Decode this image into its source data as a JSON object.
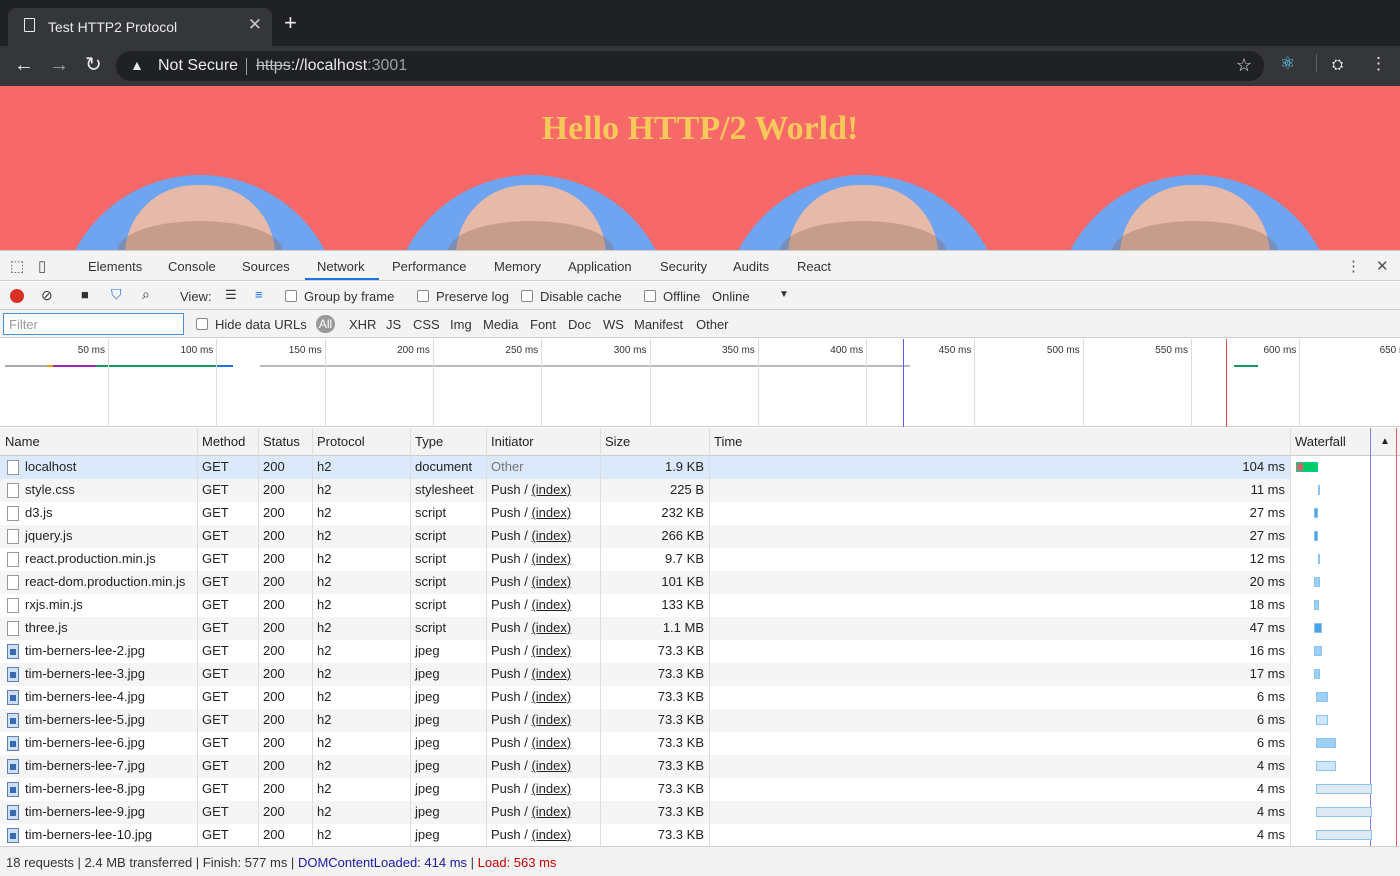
{
  "browser": {
    "tab_title": "Test HTTP2 Protocol",
    "close_glyph": "✕",
    "new_tab_glyph": "+",
    "security_label": "Not Secure",
    "url_scheme": "https",
    "url_rest": "://localhost",
    "url_port": ":3001"
  },
  "page": {
    "heading": "Hello HTTP/2 World!",
    "background": "#f76868",
    "heading_color": "#f7c95a"
  },
  "devtools": {
    "tabs": [
      "Elements",
      "Console",
      "Sources",
      "Network",
      "Performance",
      "Memory",
      "Application",
      "Security",
      "Audits",
      "React"
    ],
    "active_tab": "Network",
    "view_label": "View:",
    "group_by_frame": "Group by frame",
    "preserve_log": "Preserve log",
    "disable_cache": "Disable cache",
    "offline": "Offline",
    "throttle": "Online",
    "filter_placeholder": "Filter",
    "hide_data_urls": "Hide data URLs",
    "type_filters": [
      "All",
      "XHR",
      "JS",
      "CSS",
      "Img",
      "Media",
      "Font",
      "Doc",
      "WS",
      "Manifest",
      "Other"
    ],
    "ticks": [
      "50 ms",
      "100 ms",
      "150 ms",
      "200 ms",
      "250 ms",
      "300 ms",
      "350 ms",
      "400 ms",
      "450 ms",
      "500 ms",
      "550 ms",
      "600 ms",
      "650 n"
    ],
    "columns": [
      "Name",
      "Method",
      "Status",
      "Protocol",
      "Type",
      "Initiator",
      "Size",
      "Time",
      "Waterfall"
    ],
    "rows": [
      {
        "name": "localhost",
        "method": "GET",
        "status": "200",
        "protocol": "h2",
        "type": "document",
        "initiator": "Other",
        "size": "1.9 KB",
        "time": "104 ms",
        "icon": "file-icon"
      },
      {
        "name": "style.css",
        "method": "GET",
        "status": "200",
        "protocol": "h2",
        "type": "stylesheet",
        "initiator": "Push / ",
        "link": "(index)",
        "size": "225 B",
        "time": "11 ms",
        "icon": "file-icon"
      },
      {
        "name": "d3.js",
        "method": "GET",
        "status": "200",
        "protocol": "h2",
        "type": "script",
        "initiator": "Push / ",
        "link": "(index)",
        "size": "232 KB",
        "time": "27 ms",
        "icon": "file-icon"
      },
      {
        "name": "jquery.js",
        "method": "GET",
        "status": "200",
        "protocol": "h2",
        "type": "script",
        "initiator": "Push / ",
        "link": "(index)",
        "size": "266 KB",
        "time": "27 ms",
        "icon": "file-icon"
      },
      {
        "name": "react.production.min.js",
        "method": "GET",
        "status": "200",
        "protocol": "h2",
        "type": "script",
        "initiator": "Push / ",
        "link": "(index)",
        "size": "9.7 KB",
        "time": "12 ms",
        "icon": "file-icon"
      },
      {
        "name": "react-dom.production.min.js",
        "method": "GET",
        "status": "200",
        "protocol": "h2",
        "type": "script",
        "initiator": "Push / ",
        "link": "(index)",
        "size": "101 KB",
        "time": "20 ms",
        "icon": "file-icon"
      },
      {
        "name": "rxjs.min.js",
        "method": "GET",
        "status": "200",
        "protocol": "h2",
        "type": "script",
        "initiator": "Push / ",
        "link": "(index)",
        "size": "133 KB",
        "time": "18 ms",
        "icon": "file-icon"
      },
      {
        "name": "three.js",
        "method": "GET",
        "status": "200",
        "protocol": "h2",
        "type": "script",
        "initiator": "Push / ",
        "link": "(index)",
        "size": "1.1 MB",
        "time": "47 ms",
        "icon": "file-icon"
      },
      {
        "name": "tim-berners-lee-2.jpg",
        "method": "GET",
        "status": "200",
        "protocol": "h2",
        "type": "jpeg",
        "initiator": "Push / ",
        "link": "(index)",
        "size": "73.3 KB",
        "time": "16 ms",
        "icon": "image-icon"
      },
      {
        "name": "tim-berners-lee-3.jpg",
        "method": "GET",
        "status": "200",
        "protocol": "h2",
        "type": "jpeg",
        "initiator": "Push / ",
        "link": "(index)",
        "size": "73.3 KB",
        "time": "17 ms",
        "icon": "image-icon"
      },
      {
        "name": "tim-berners-lee-4.jpg",
        "method": "GET",
        "status": "200",
        "protocol": "h2",
        "type": "jpeg",
        "initiator": "Push / ",
        "link": "(index)",
        "size": "73.3 KB",
        "time": "6 ms",
        "icon": "image-icon"
      },
      {
        "name": "tim-berners-lee-5.jpg",
        "method": "GET",
        "status": "200",
        "protocol": "h2",
        "type": "jpeg",
        "initiator": "Push / ",
        "link": "(index)",
        "size": "73.3 KB",
        "time": "6 ms",
        "icon": "image-icon"
      },
      {
        "name": "tim-berners-lee-6.jpg",
        "method": "GET",
        "status": "200",
        "protocol": "h2",
        "type": "jpeg",
        "initiator": "Push / ",
        "link": "(index)",
        "size": "73.3 KB",
        "time": "6 ms",
        "icon": "image-icon"
      },
      {
        "name": "tim-berners-lee-7.jpg",
        "method": "GET",
        "status": "200",
        "protocol": "h2",
        "type": "jpeg",
        "initiator": "Push / ",
        "link": "(index)",
        "size": "73.3 KB",
        "time": "4 ms",
        "icon": "image-icon"
      },
      {
        "name": "tim-berners-lee-8.jpg",
        "method": "GET",
        "status": "200",
        "protocol": "h2",
        "type": "jpeg",
        "initiator": "Push / ",
        "link": "(index)",
        "size": "73.3 KB",
        "time": "4 ms",
        "icon": "image-icon"
      },
      {
        "name": "tim-berners-lee-9.jpg",
        "method": "GET",
        "status": "200",
        "protocol": "h2",
        "type": "jpeg",
        "initiator": "Push / ",
        "link": "(index)",
        "size": "73.3 KB",
        "time": "4 ms",
        "icon": "image-icon"
      },
      {
        "name": "tim-berners-lee-10.jpg",
        "method": "GET",
        "status": "200",
        "protocol": "h2",
        "type": "jpeg",
        "initiator": "Push / ",
        "link": "(index)",
        "size": "73.3 KB",
        "time": "4 ms",
        "icon": "image-icon"
      }
    ],
    "status": {
      "summary": "18 requests | 2.4 MB transferred | Finish: 577 ms | ",
      "dcl": "DOMContentLoaded: 414 ms",
      "divider": " | ",
      "load": "Load: 563 ms"
    }
  }
}
